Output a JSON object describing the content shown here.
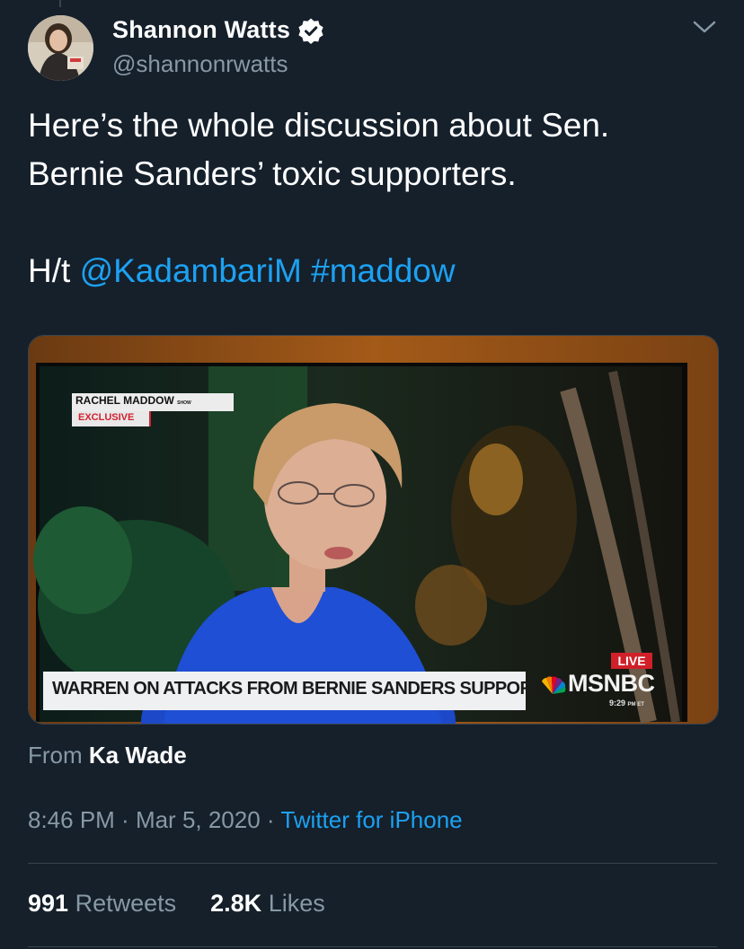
{
  "author": {
    "display_name": "Shannon Watts",
    "handle": "@shannonrwatts",
    "verified": true
  },
  "tweet": {
    "line1": "Here’s the whole discussion about Sen.",
    "line2": "Bernie Sanders’ toxic supporters.",
    "ht_prefix": "H/t ",
    "mention": "@KadambariM",
    "hashtag": "#maddow"
  },
  "media": {
    "show_name": "RACHEL MADDOW",
    "show_suffix": "SHOW",
    "exclusive_label": "EXCLUSIVE",
    "lower_third": "WARREN ON ATTACKS FROM BERNIE SANDERS SUPPORTERS",
    "live_label": "LIVE",
    "network": "MSNBC",
    "clock": "9:29",
    "clock_suffix": "PM ET"
  },
  "attribution": {
    "prefix": "From",
    "name": "Ka Wade"
  },
  "meta": {
    "time": "8:46 PM",
    "separator": " · ",
    "date": "Mar 5, 2020",
    "source": "Twitter for iPhone"
  },
  "stats": {
    "retweets_count": "991",
    "retweets_label": "Retweets",
    "likes_count": "2.8K",
    "likes_label": "Likes"
  },
  "colors": {
    "background": "#15202b",
    "link": "#1da1f2",
    "secondary_text": "#8899a6",
    "divider": "#38444d"
  }
}
